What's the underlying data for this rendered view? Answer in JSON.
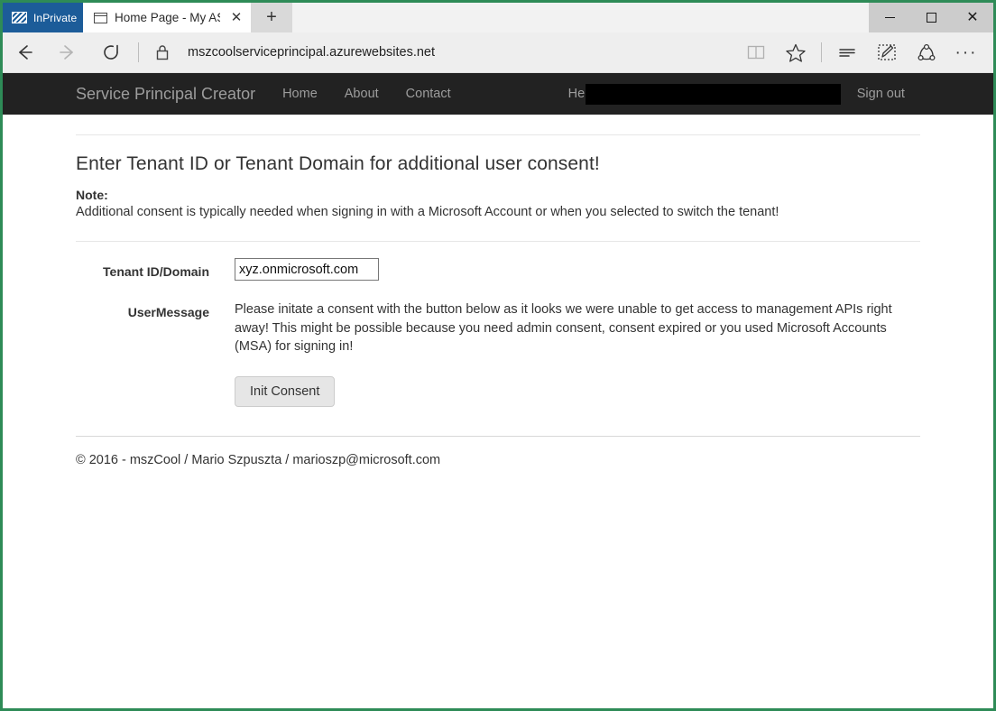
{
  "browser": {
    "inprivate_label": "InPrivate",
    "tab": {
      "title": "Home Page - My ASP.NI",
      "close_label": "✕",
      "favicon_name": "page-icon"
    },
    "new_tab_label": "+",
    "window_controls": {
      "minimize": "—",
      "maximize": "□",
      "close": "✕"
    },
    "toolbar": {
      "back_label": "Back",
      "forward_label": "Forward",
      "refresh_label": "Refresh",
      "lock_label": "Secure",
      "url": "mszcoolserviceprincipal.azurewebsites.net",
      "reading_view_label": "Reading view",
      "favorites_label": "Add to favorites",
      "hub_label": "Hub",
      "web_note_label": "Make a Web Note",
      "share_label": "Share",
      "more_label": "More",
      "more_glyph": "···"
    }
  },
  "site": {
    "brand": "Service Principal Creator",
    "nav_links": [
      {
        "label": "Home"
      },
      {
        "label": "About"
      },
      {
        "label": "Contact"
      }
    ],
    "user": {
      "greeting": "Hello,",
      "name_redacted": "",
      "sign_out": "Sign out"
    }
  },
  "main": {
    "title": "Enter Tenant ID or Tenant Domain for additional user consent!",
    "note_label": "Note:",
    "note_text": "Additional consent is typically needed when signing in with a Microsoft Account or when you selected to switch the tenant!",
    "form": {
      "tenant": {
        "label": "Tenant ID/Domain",
        "value": "xyz.onmicrosoft.com",
        "placeholder": ""
      },
      "usermessage": {
        "label": "UserMessage",
        "text": "Please initate a consent with the button below as it looks we were unable to get access to management APIs right away! This might be possible because you need admin consent, consent expired or you used Microsoft Accounts (MSA) for signing in!"
      },
      "submit_label": "Init Consent"
    }
  },
  "footer": {
    "text": "© 2016 - mszCool / Mario Szpuszta / marioszp@microsoft.com"
  },
  "colors": {
    "window_border": "#2e8b57",
    "inprivate_badge": "#1C5C99",
    "navbar_bg": "#222222",
    "navbar_text": "#9d9d9d",
    "toolbar_bg": "#eeeeee",
    "redaction": "#000000"
  }
}
